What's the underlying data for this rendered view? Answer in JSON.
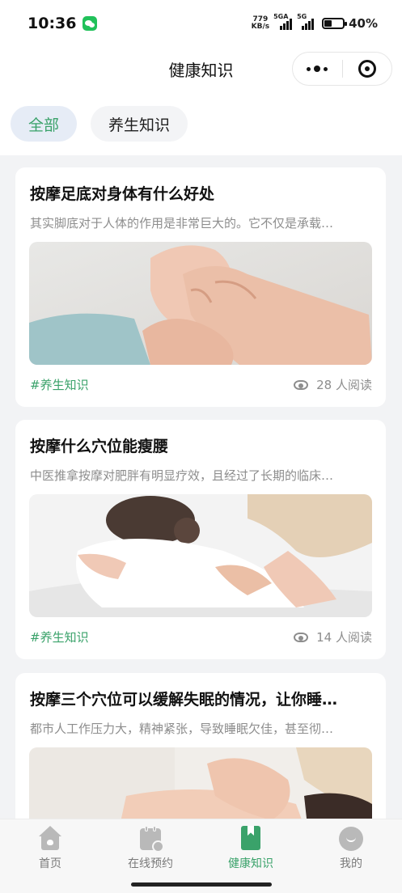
{
  "status_bar": {
    "time": "10:36",
    "net_speed_value": "779",
    "net_speed_unit": "KB/s",
    "signal1_label": "5GA",
    "signal2_label": "5G",
    "battery": "40%"
  },
  "navbar": {
    "title": "健康知识"
  },
  "tabs": [
    {
      "label": "全部",
      "active": true
    },
    {
      "label": "养生知识",
      "active": false
    }
  ],
  "articles": [
    {
      "title": "按摩足底对身体有什么好处",
      "summary": "其实脚底对于人体的作用是非常巨大的。它不仅是承载…",
      "tag": "#养生知识",
      "reads": "28 人阅读",
      "image": "foot-massage-photo"
    },
    {
      "title": "按摩什么穴位能瘦腰",
      "summary": "中医推拿按摩对肥胖有明显疗效，且经过了长期的临床…",
      "tag": "#养生知识",
      "reads": "14 人阅读",
      "image": "waist-massage-photo"
    },
    {
      "title": "按摩三个穴位可以缓解失眠的情况，让你睡…",
      "summary": "都市人工作压力大，精神紧张，导致睡眠欠佳，甚至彻…",
      "image": "back-massage-photo"
    }
  ],
  "tabbar": [
    {
      "label": "首页",
      "icon": "home-icon",
      "active": false
    },
    {
      "label": "在线预约",
      "icon": "calendar-icon",
      "active": false
    },
    {
      "label": "健康知识",
      "icon": "book-icon",
      "active": true
    },
    {
      "label": "我的",
      "icon": "profile-icon",
      "active": false
    }
  ],
  "colors": {
    "accent": "#3aa26a",
    "active_tab_bg": "#e6ecf6",
    "muted_text": "#8d8d8d",
    "page_bg": "#f2f3f5"
  }
}
